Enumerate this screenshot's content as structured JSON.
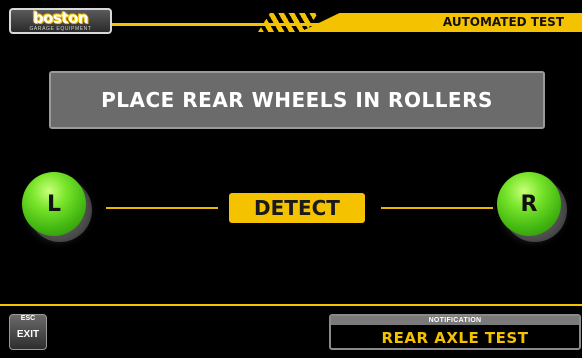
{
  "header": {
    "logo_text": "boston",
    "logo_subtext": "GARAGE EQUIPMENT",
    "title": "AUTOMATED TEST"
  },
  "instruction": {
    "text": "PLACE REAR WHEELS IN ROLLERS"
  },
  "detect_row": {
    "left_wheel": "L",
    "right_wheel": "R",
    "status": "DETECT"
  },
  "footer": {
    "exit": {
      "shortcut": "ESC",
      "label": "EXIT"
    },
    "notification": {
      "label": "NOTIFICATION",
      "text": "REAR AXLE TEST"
    }
  },
  "colors": {
    "accent": "#f5c200",
    "wheel_green": "#43b712",
    "background": "#000000",
    "panel_grey": "#6b6b6b"
  }
}
